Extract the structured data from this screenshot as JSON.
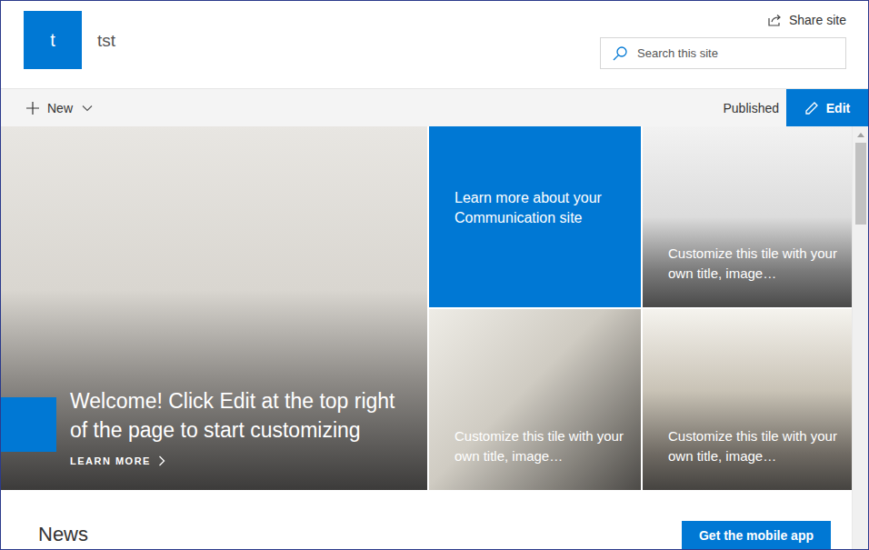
{
  "site": {
    "logo_letter": "t",
    "title": "tst"
  },
  "header": {
    "share": "Share site",
    "search": {
      "placeholder": "Search this site"
    }
  },
  "command_bar": {
    "new": "New",
    "status": "Published",
    "edit": "Edit"
  },
  "hero": {
    "main": {
      "title": "Welcome! Click Edit at the top right of the page to start customizing",
      "link": "LEARN MORE"
    },
    "tiles": [
      {
        "kind": "text",
        "title": "Learn more about your Communication site"
      },
      {
        "kind": "image",
        "title": "Customize this tile with your own title, image…"
      },
      {
        "kind": "image",
        "title": "Customize this tile with your own title, image…"
      },
      {
        "kind": "image",
        "title": "Customize this tile with your own title, image…"
      }
    ]
  },
  "news": {
    "title": "News",
    "button": "Get the mobile app"
  }
}
